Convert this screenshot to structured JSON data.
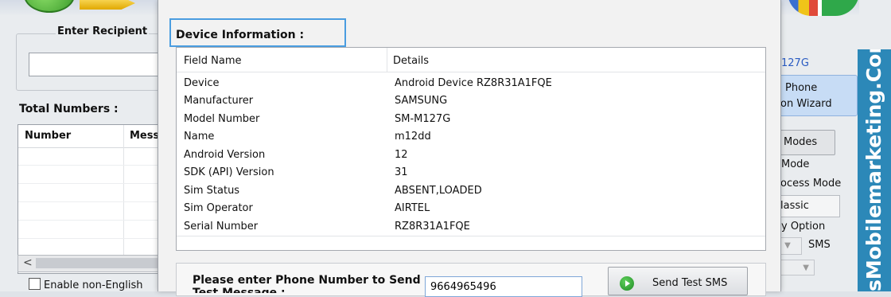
{
  "background_app": {
    "recipient_label": "Enter Recipient",
    "total_numbers_label": "Total Numbers :",
    "grid": {
      "col_number": "Number",
      "col_message": "Mess"
    },
    "scroll_left_glyph": "<",
    "enable_label": "Enable non-English",
    "right_panel": {
      "model_fragment": "127G",
      "wizard_phone": "Phone",
      "wizard_label": "on  Wizard",
      "modes_button": "Modes",
      "mode_label": "Mode",
      "process_mode_label": "rocess Mode",
      "classic_label": "lassic",
      "option_label": "y Option",
      "sms_label": "SMS"
    },
    "brand_text": "sMobilemarketing.Com"
  },
  "dialog": {
    "title": "Device Information :",
    "table": {
      "headers": {
        "field": "Field Name",
        "details": "Details"
      },
      "rows": [
        {
          "field": "Device",
          "value": "Android Device RZ8R31A1FQE"
        },
        {
          "field": "Manufacturer",
          "value": "SAMSUNG"
        },
        {
          "field": "Model Number",
          "value": "SM-M127G"
        },
        {
          "field": "Name",
          "value": "m12dd"
        },
        {
          "field": "Android Version",
          "value": "12"
        },
        {
          "field": "SDK (API) Version",
          "value": "31"
        },
        {
          "field": "Sim Status",
          "value": "ABSENT,LOADED"
        },
        {
          "field": "Sim Operator",
          "value": "AIRTEL"
        },
        {
          "field": "Serial Number",
          "value": "RZ8R31A1FQE"
        }
      ]
    },
    "test": {
      "label": "Please enter Phone Number to Send Test Message :",
      "phone_value": "9664965496",
      "send_button": "Send Test SMS"
    }
  },
  "colors": {
    "brand_banner": "#2c88b8",
    "title_highlight": "#4a9de0",
    "send_icon": "#1f8a24"
  }
}
